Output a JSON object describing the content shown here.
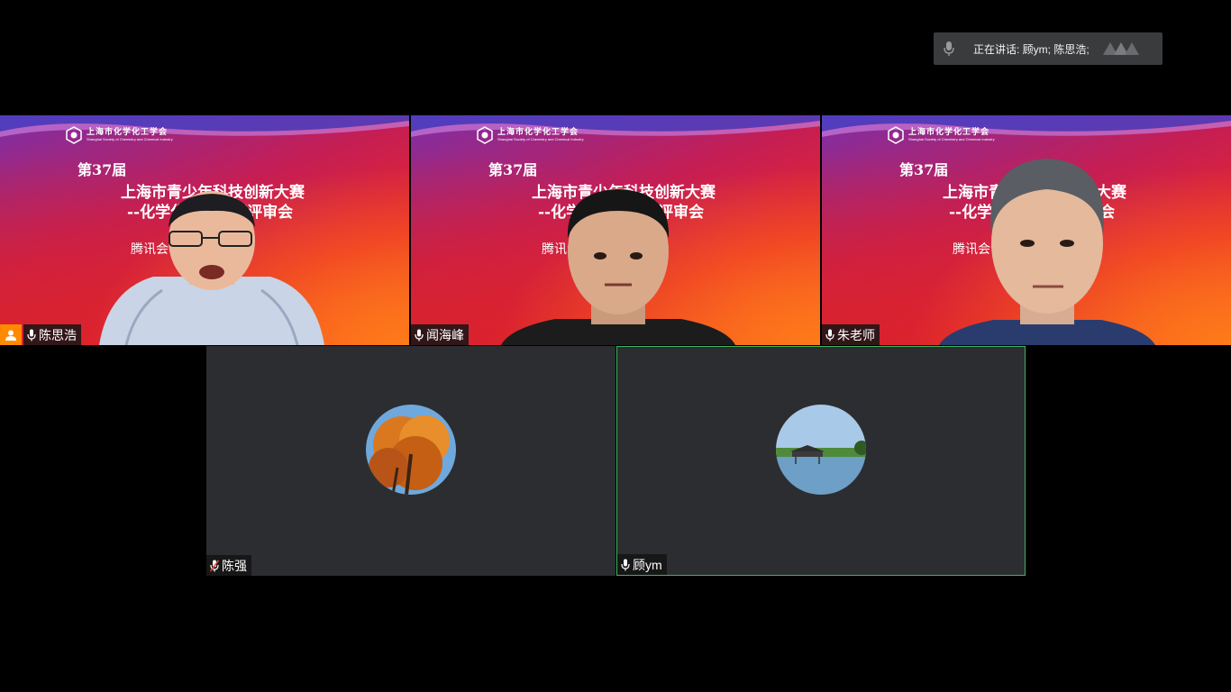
{
  "speaking": {
    "text": "正在讲话: 顾ym; 陈思浩;",
    "mic_icon": "mic-icon",
    "logo_icon": "tencent-meeting-logo-icon"
  },
  "slide": {
    "org_cn": "上海市化学化工学会",
    "org_en": "Shanghai Society of Chemistry and Chemical Industry",
    "edition": "第37届",
    "line1": "上海市青少年科技创新大赛",
    "line2": "--化学化工专项奖评审会",
    "line3": "腾讯会议号：        353"
  },
  "participants": [
    {
      "name": "陈思浩",
      "mic": "mic-on",
      "host": true,
      "video": true
    },
    {
      "name": "闻海峰",
      "mic": "mic-on",
      "host": false,
      "video": true
    },
    {
      "name": "朱老师",
      "mic": "mic-on",
      "host": false,
      "video": true
    },
    {
      "name": "陈强",
      "mic": "mic-muted",
      "host": false,
      "video": false,
      "avatar": "autumn-tree"
    },
    {
      "name": "顾ym",
      "mic": "mic-on",
      "host": false,
      "video": false,
      "avatar": "lake-pavilion",
      "active_speaker": true
    }
  ],
  "colors": {
    "active_border": "#3fb55e",
    "host_badge": "#ff8a00",
    "tile_bg": "#2c2d30"
  }
}
